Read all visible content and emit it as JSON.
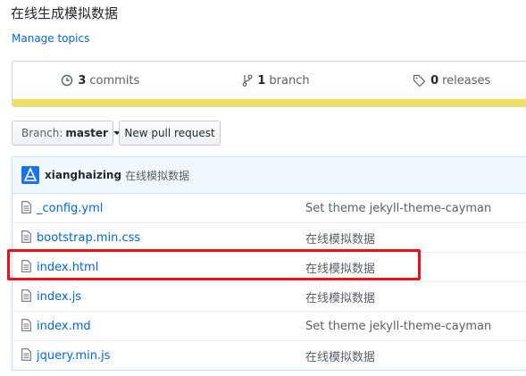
{
  "repo": {
    "description": "在线生成模拟数据",
    "manage_topics": "Manage topics"
  },
  "summary": {
    "commits": {
      "count": "3",
      "label": "commits",
      "icon": "history-icon"
    },
    "branches": {
      "count": "1",
      "label": "branch",
      "icon": "git-branch-icon"
    },
    "releases": {
      "count": "0",
      "label": "releases",
      "icon": "tag-icon"
    },
    "language_bar_color": "#f1e05a"
  },
  "toolbar": {
    "branch_label": "Branch:",
    "branch_name": "master",
    "new_pr_label": "New pull request"
  },
  "latest_commit": {
    "author": "xianghaizing",
    "message": "在线模拟数据"
  },
  "files": [
    {
      "name": "_config.yml",
      "commit": "Set theme jekyll-theme-cayman"
    },
    {
      "name": "bootstrap.min.css",
      "commit": "在线模拟数据"
    },
    {
      "name": "index.html",
      "commit": "在线模拟数据"
    },
    {
      "name": "index.js",
      "commit": "在线模拟数据"
    },
    {
      "name": "index.md",
      "commit": "Set theme jekyll-theme-cayman"
    },
    {
      "name": "jquery.min.js",
      "commit": "在线模拟数据"
    }
  ],
  "colors": {
    "link": "#0366d6",
    "highlight_box": "#e8131a"
  }
}
